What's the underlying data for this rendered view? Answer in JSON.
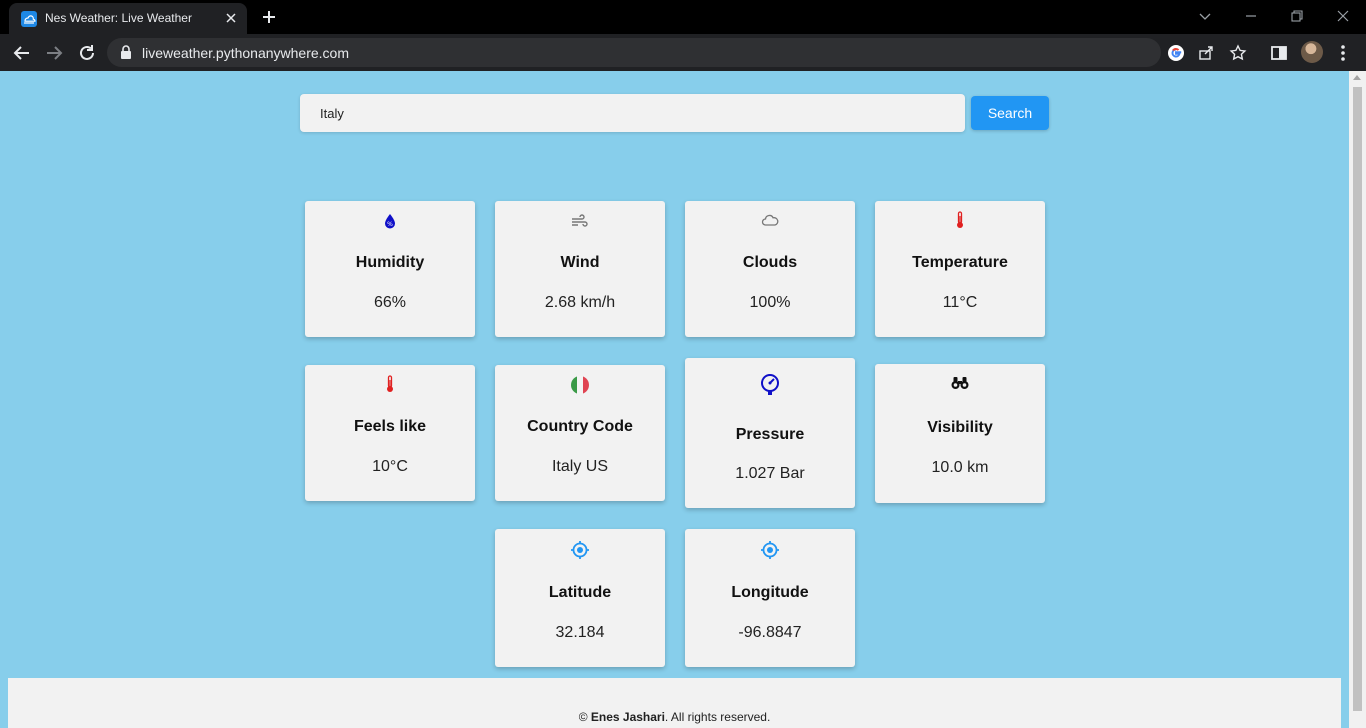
{
  "browser": {
    "tab_title": "Nes Weather: Live Weather",
    "url": "liveweather.pythonanywhere.com"
  },
  "search": {
    "value": "Italy",
    "button_label": "Search"
  },
  "cards": {
    "humidity": {
      "label": "Humidity",
      "value": "66%",
      "icon": "humidity-drop-icon"
    },
    "wind": {
      "label": "Wind",
      "value": "2.68 km/h",
      "icon": "wind-icon"
    },
    "clouds": {
      "label": "Clouds",
      "value": "100%",
      "icon": "cloud-icon"
    },
    "temperature": {
      "label": "Temperature",
      "value": "11°C",
      "icon": "thermometer-icon"
    },
    "feels_like": {
      "label": "Feels like",
      "value": "10°C",
      "icon": "thermometer-icon"
    },
    "country_code": {
      "label": "Country Code",
      "value": "Italy US",
      "icon": "italy-flag-icon"
    },
    "pressure": {
      "label": "Pressure",
      "value": "1.027 Bar",
      "icon": "gauge-icon"
    },
    "visibility": {
      "label": "Visibility",
      "value": "10.0 km",
      "icon": "binoculars-icon"
    },
    "latitude": {
      "label": "Latitude",
      "value": "32.184",
      "icon": "crosshair-icon"
    },
    "longitude": {
      "label": "Longitude",
      "value": "-96.8847",
      "icon": "crosshair-icon"
    }
  },
  "footer": {
    "copyright_symbol": "©",
    "author": "Enes Jashari",
    "rights": ". All rights reserved."
  },
  "colors": {
    "page_background": "#87ceeb",
    "card_background": "#f2f2f2",
    "search_button": "#2196f3",
    "humidity_icon": "#1010c8",
    "thermometer_icon": "#e02020",
    "location_icon": "#2196f3"
  }
}
